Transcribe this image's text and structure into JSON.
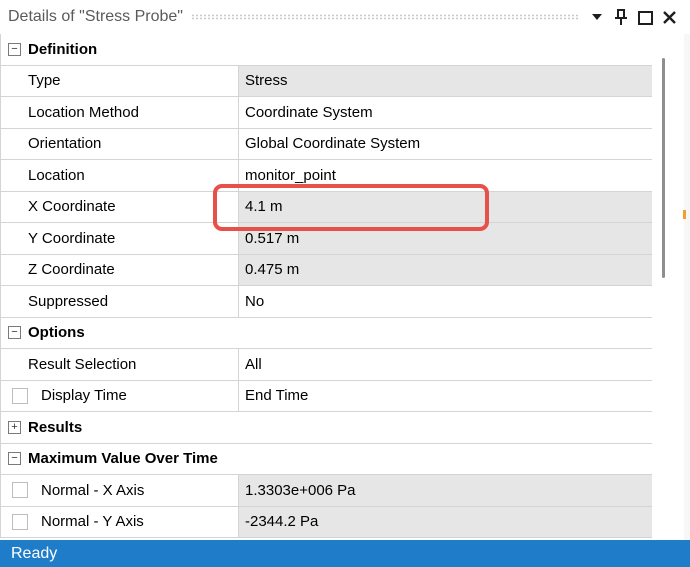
{
  "window": {
    "title": "Details of \"Stress Probe\"",
    "controls": {
      "dropdown_icon": "chevron-down-icon",
      "pin_icon": "pin-icon",
      "maximize_icon": "maximize-icon",
      "close_icon": "close-icon"
    }
  },
  "groups": {
    "definition": {
      "label": "Definition",
      "expander": "−",
      "rows": [
        {
          "label": "Type",
          "value": "Stress"
        },
        {
          "label": "Location Method",
          "value": "Coordinate System"
        },
        {
          "label": "Orientation",
          "value": "Global Coordinate System"
        },
        {
          "label": "Location",
          "value": "monitor_point"
        },
        {
          "label": "X Coordinate",
          "value": "4.1 m"
        },
        {
          "label": "Y Coordinate",
          "value": "0.517 m"
        },
        {
          "label": "Z Coordinate",
          "value": "0.475 m"
        },
        {
          "label": "Suppressed",
          "value": "No"
        }
      ]
    },
    "options": {
      "label": "Options",
      "expander": "−",
      "rows": [
        {
          "label": "Result Selection",
          "value": "All"
        },
        {
          "label": "Display Time",
          "value": "End Time"
        }
      ]
    },
    "results": {
      "label": "Results",
      "expander": "+"
    },
    "max_value": {
      "label": "Maximum Value Over Time",
      "expander": "−",
      "rows": [
        {
          "label": "Normal - X Axis",
          "value": "1.3303e+006 Pa"
        },
        {
          "label": "Normal - Y Axis",
          "value": "-2344.2 Pa"
        }
      ]
    }
  },
  "status": {
    "text": "Ready"
  },
  "colors": {
    "status_bar": "#1f7cc9",
    "highlight": "#e8504a",
    "value_cell": "#e6e6e6"
  }
}
